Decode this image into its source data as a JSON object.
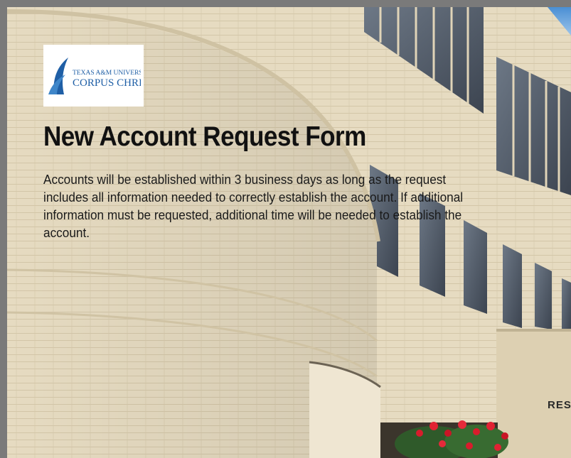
{
  "logo": {
    "line1": "TEXAS A&M UNIVERSITY",
    "line2": "CORPUS CHRISTI",
    "icon": "tamucc-logo-icon"
  },
  "page": {
    "title": "New Account Request Form",
    "description": "Accounts will be established within 3 business days as long as the request includes all information needed to correctly establish the account. If additional information must be requested, additional time will be needed to establish the account."
  },
  "background": {
    "sign_text": "RES"
  },
  "colors": {
    "brand_blue": "#1f5fa6",
    "wall": "#e4d8bd",
    "text": "#111111"
  }
}
